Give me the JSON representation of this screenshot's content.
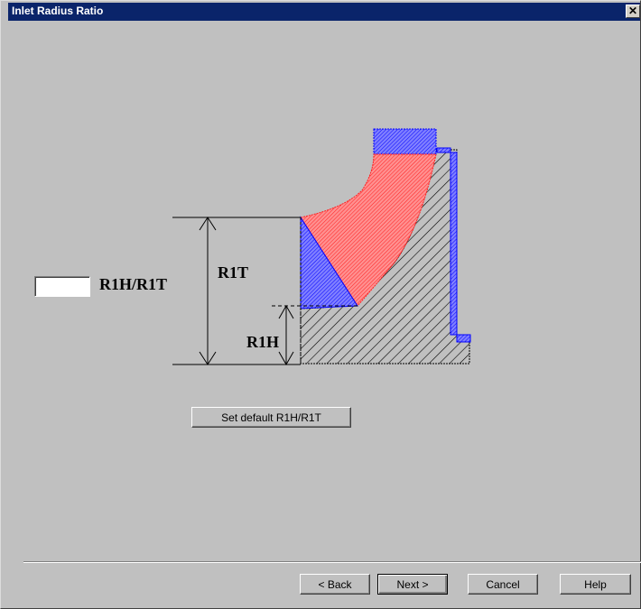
{
  "window": {
    "title": "Inlet Radius Ratio",
    "close_glyph": "✕"
  },
  "input": {
    "value": "",
    "label": "R1H/R1T"
  },
  "diagram": {
    "label_r1t": "R1T",
    "label_r1h": "R1H",
    "colors": {
      "blue": "#0000ff",
      "red": "#ff2020",
      "hatch": "#000000"
    }
  },
  "buttons": {
    "set_default": "Set default R1H/R1T",
    "back": "< Back",
    "next": "Next >",
    "cancel": "Cancel",
    "help": "Help"
  }
}
